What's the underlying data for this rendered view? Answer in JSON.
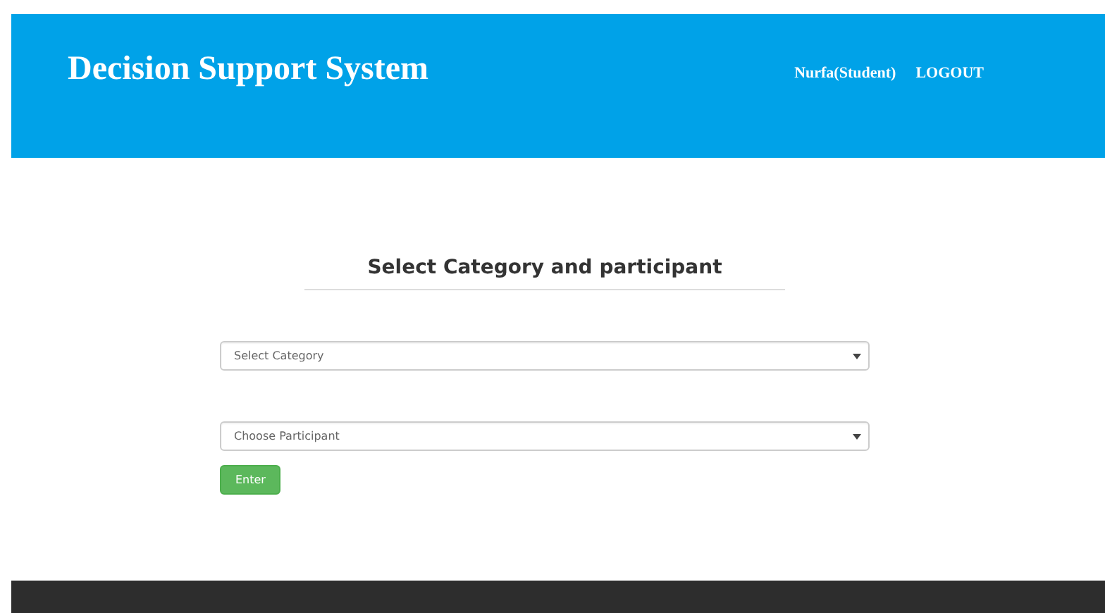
{
  "header": {
    "title": "Decision Support System",
    "user": "Nurfa(Student)",
    "logout": "LOGOUT"
  },
  "form": {
    "heading": "Select Category and participant",
    "selects": [
      {
        "placeholder": "Select Category"
      },
      {
        "placeholder": "Choose Participant"
      }
    ],
    "submit": "Enter"
  }
}
